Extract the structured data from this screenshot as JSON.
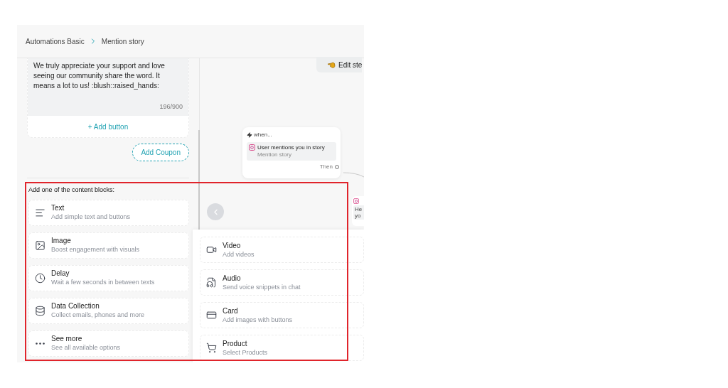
{
  "breadcrumb": [
    {
      "label": "Automations Basic"
    },
    {
      "label": "Mention story"
    }
  ],
  "message": {
    "text": "We truly appreciate your support and love seeing our community share the word. It means a lot to us! :blush::raised_hands:",
    "counter": "196/900",
    "add_button": "+ Add button"
  },
  "add_coupon": "Add Coupon",
  "blocks_heading": "Add one of the content blocks:",
  "blocks": [
    {
      "kind": "text",
      "title": "Text",
      "subtitle": "Add simple text and buttons"
    },
    {
      "kind": "image",
      "title": "Image",
      "subtitle": "Boost engagement with visuals"
    },
    {
      "kind": "delay",
      "title": "Delay",
      "subtitle": "Wait a few seconds in between texts"
    },
    {
      "kind": "data",
      "title": "Data Collection",
      "subtitle": "Collect emails, phones and more"
    },
    {
      "kind": "more",
      "title": "See more",
      "subtitle": "See all available options"
    }
  ],
  "more_blocks": [
    {
      "kind": "video",
      "title": "Video",
      "subtitle": "Add videos"
    },
    {
      "kind": "audio",
      "title": "Audio",
      "subtitle": "Send voice snippets in chat"
    },
    {
      "kind": "card",
      "title": "Card",
      "subtitle": "Add images with buttons"
    },
    {
      "kind": "product",
      "title": "Product",
      "subtitle": "Select Products"
    }
  ],
  "canvas": {
    "edit_button": "Edit ste",
    "trigger": {
      "label": "when...",
      "title": "User mentions you in story",
      "subtitle": "Mention story",
      "port": "Then"
    },
    "partial_node": {
      "lines": [
        "He",
        "yo"
      ]
    }
  }
}
